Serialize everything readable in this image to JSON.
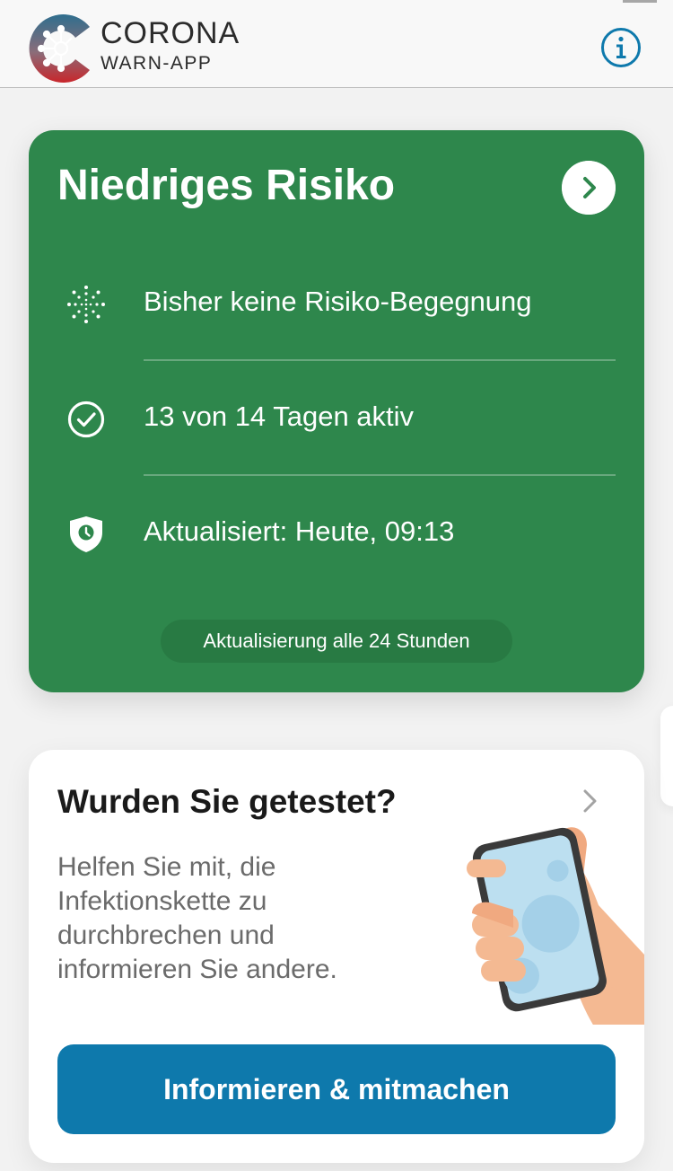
{
  "header": {
    "logo_title": "CORONA",
    "logo_subtitle": "WARN-APP",
    "info_icon": "info-icon"
  },
  "risk_card": {
    "title": "Niedriges Risiko",
    "background_color": "#2e874c",
    "rows": [
      {
        "icon": "virus-dots-icon",
        "text": "Bisher keine Risiko-Begegnung"
      },
      {
        "icon": "check-circle-icon",
        "text": "13 von 14 Tagen aktiv"
      },
      {
        "icon": "shield-clock-icon",
        "text": "Aktualisiert: Heute, 09:13"
      }
    ],
    "update_note": "Aktualisierung alle 24 Stunden"
  },
  "test_card": {
    "title": "Wurden Sie getestet?",
    "body": "Helfen Sie mit, die Infektionskette zu durchbrechen und informieren Sie andere.",
    "button_label": "Informieren & mitmachen",
    "button_color": "#0e79ac",
    "illustration": "hand-holding-phone-illustration"
  }
}
